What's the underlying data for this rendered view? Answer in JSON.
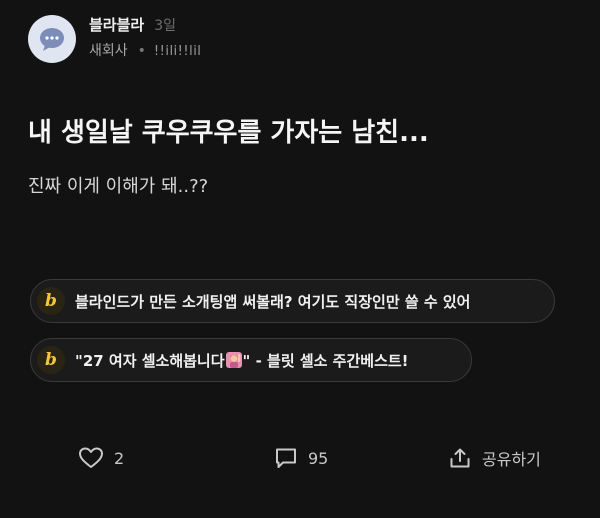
{
  "post": {
    "author": "블라블라",
    "time": "3일",
    "company": "새회사",
    "separator": "•",
    "nickname": "!!ili!!lil",
    "title": "내 생일날 쿠우쿠우를 가자는 남친...",
    "body": "진짜 이게 이해가 돼..??"
  },
  "promos": [
    {
      "logo": "b",
      "text": "블라인드가 만든 소개팅앱 써볼래? 여기도 직장인만 쓸 수 있어"
    },
    {
      "logo": "b",
      "text_before": "\"27 여자 셀소해봅니다",
      "text_after": "\" - 블릿 셀소 주간베스트!",
      "emoji": "person-raising-hand-emoji"
    }
  ],
  "actions": {
    "like_count": "2",
    "comment_count": "95",
    "share_label": "공유하기"
  },
  "colors": {
    "background": "#121212",
    "brand_yellow": "#f4c63b",
    "avatar_bg": "#dfe6f2",
    "avatar_bubble": "#7b8db8"
  }
}
